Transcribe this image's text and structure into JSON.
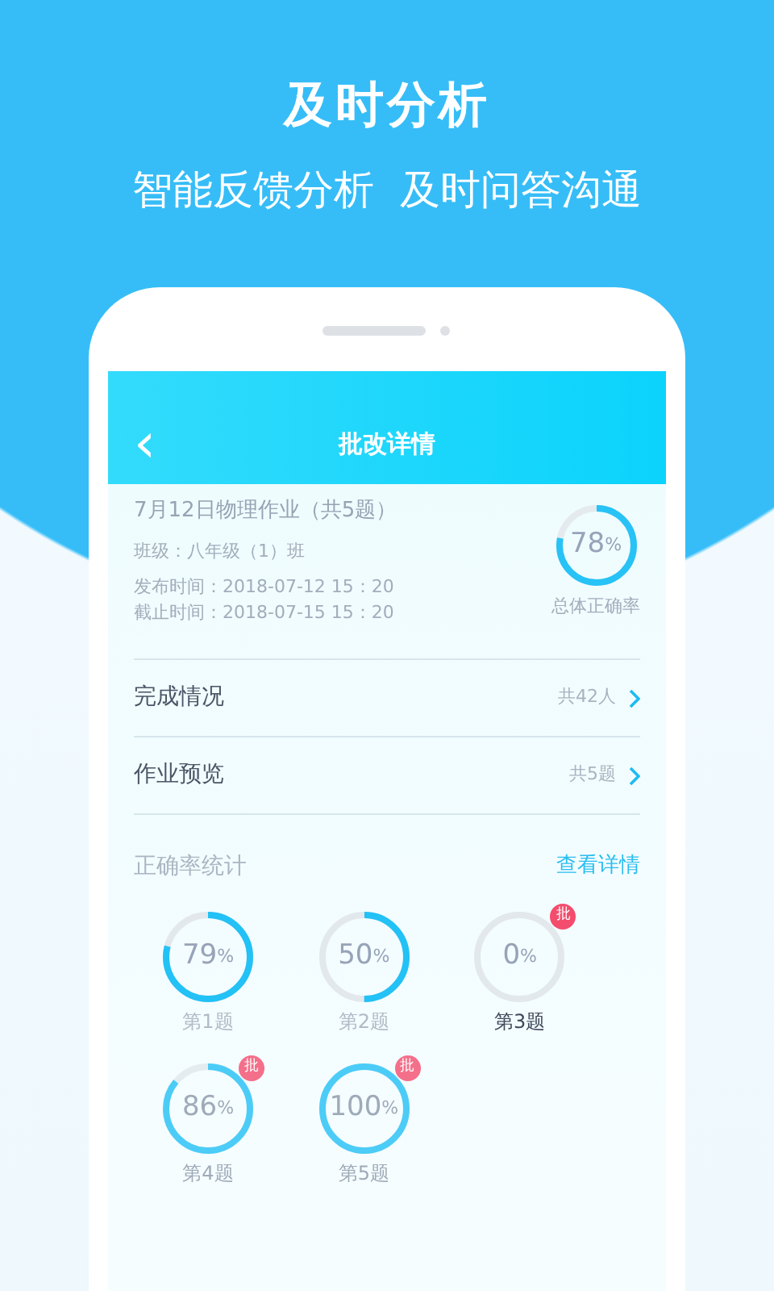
{
  "promo": {
    "headline": "及时分析",
    "tagline": "智能反馈分析  及时问答沟通"
  },
  "screen": {
    "title": "批改详情",
    "back_icon": "‹"
  },
  "assignment": {
    "name": "7月12日物理作业（共5题）",
    "class": "班级：八年级（1）班",
    "published": "发布时间：2018-07-12  15：20",
    "deadline": "截止时间：2018-07-15  15：20",
    "overall": {
      "value": "78",
      "unit": "%",
      "level": 0.78,
      "label": "总体正确率"
    }
  },
  "links": [
    {
      "label": "完成情况",
      "count": "共42人"
    },
    {
      "label": "作业预览",
      "count": "共5题"
    }
  ],
  "stats": {
    "title": "正确率统计",
    "more": "查看详情",
    "questions": [
      {
        "value": "79",
        "unit": "%",
        "level": 0.79,
        "label": "第1题",
        "selected": false
      },
      {
        "value": "50",
        "unit": "%",
        "level": 0.5,
        "label": "第2题",
        "selected": false
      },
      {
        "value": "0",
        "unit": "%",
        "level": 0,
        "label": "第3题",
        "selected": true,
        "badge": "批"
      },
      {
        "value": "86",
        "unit": "%",
        "level": 0.86,
        "label": "第4题",
        "selected": false,
        "badge": "批"
      },
      {
        "value": "100",
        "unit": "%",
        "level": 1,
        "label": "第5题",
        "selected": false,
        "badge": "批"
      }
    ]
  }
}
